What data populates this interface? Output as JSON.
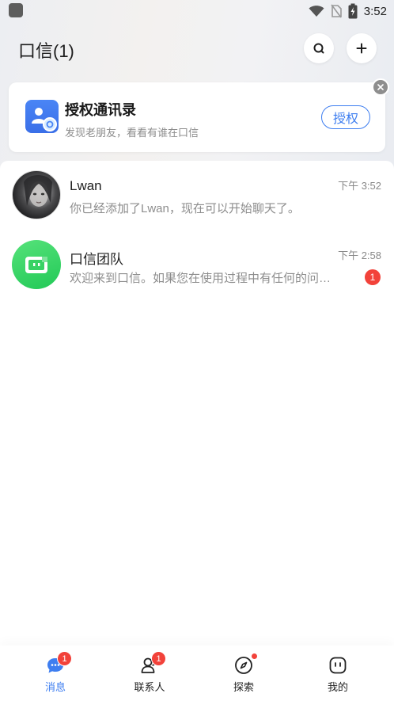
{
  "status_bar": {
    "time": "3:52",
    "icons": [
      "app-icon",
      "wifi-icon",
      "no-sim-icon",
      "battery-charging-icon"
    ]
  },
  "header": {
    "title": "口信(1)",
    "search_icon": "search-icon",
    "add_icon": "plus-icon"
  },
  "contacts_prompt": {
    "title": "授权通讯录",
    "subtitle": "发现老朋友，看看有谁在口信",
    "button_label": "授权",
    "close_icon": "close-icon"
  },
  "conversations": [
    {
      "name": "Lwan",
      "time": "下午 3:52",
      "preview": "你已经添加了Lwan，现在可以开始聊天了。",
      "unread": ""
    },
    {
      "name": "口信团队",
      "time": "下午 2:58",
      "preview": "欢迎来到口信。如果您在使用过程中有任何的问…",
      "unread": "1"
    }
  ],
  "bottom_nav": {
    "items": [
      {
        "label": "消息",
        "icon": "chat-bubble-icon",
        "badge": "1",
        "active": true
      },
      {
        "label": "联系人",
        "icon": "contacts-icon",
        "badge": "1",
        "active": false
      },
      {
        "label": "探索",
        "icon": "compass-icon",
        "badge": "",
        "active": false
      },
      {
        "label": "我的",
        "icon": "profile-face-icon",
        "badge": "",
        "active": false
      }
    ]
  },
  "colors": {
    "accent": "#3e7ef0",
    "badge": "#f2423a",
    "team_avatar": "#2fd15c"
  }
}
